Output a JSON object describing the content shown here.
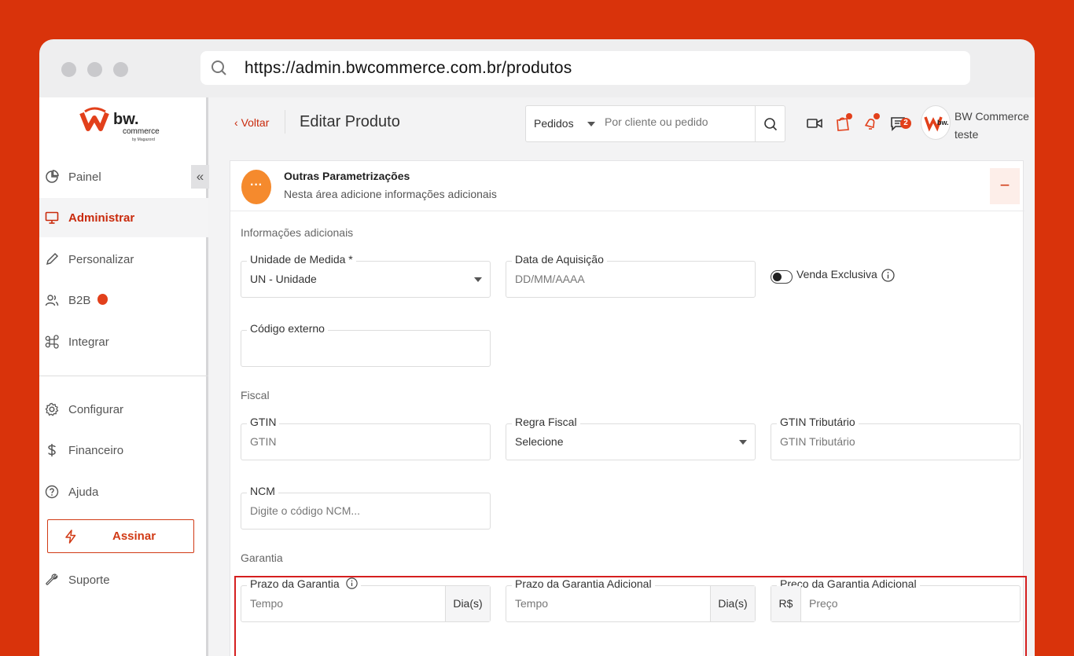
{
  "browser": {
    "url": "https://admin.bwcommerce.com.br/produtos"
  },
  "brand": {
    "logo_text": "bw.",
    "logo_sub": "commerce",
    "logo_by": "by Magazord",
    "accent": "#c92a0c"
  },
  "sidebar": {
    "items": [
      {
        "label": "Painel",
        "icon": "pie-chart-icon"
      },
      {
        "label": "Administrar",
        "icon": "monitor-icon",
        "active": true
      },
      {
        "label": "Personalizar",
        "icon": "pencil-icon"
      },
      {
        "label": "B2B",
        "icon": "users-icon"
      },
      {
        "label": "Integrar",
        "icon": "command-icon"
      },
      {
        "label": "Configurar",
        "icon": "gear-icon"
      },
      {
        "label": "Financeiro",
        "icon": "dollar-icon"
      },
      {
        "label": "Ajuda",
        "icon": "help-icon"
      }
    ],
    "assinar": "Assinar",
    "suporte": "Suporte",
    "collapse": "«"
  },
  "header": {
    "back": "Voltar",
    "title": "Editar Produto",
    "search_scope": "Pedidos",
    "search_placeholder": "Por cliente ou pedido",
    "chat_badge": "2",
    "user_name": "BW Commerce",
    "user_role": "teste"
  },
  "section": {
    "title": "Outras Parametrizações",
    "subtitle": "Nesta área adicione informações adicionais",
    "icon_text": "···",
    "collapse": "−"
  },
  "info": {
    "group": "Informações adicionais",
    "unidade_label": "Unidade de Medida *",
    "unidade_value": "UN - Unidade",
    "data_label": "Data de Aquisição",
    "data_placeholder": "DD/MM/AAAA",
    "venda_exclusiva": "Venda Exclusiva",
    "codigo_label": "Código externo"
  },
  "fiscal": {
    "group": "Fiscal",
    "gtin_label": "GTIN",
    "gtin_placeholder": "GTIN",
    "regra_label": "Regra Fiscal",
    "regra_value": "Selecione",
    "gtin_trib_label": "GTIN Tributário",
    "gtin_trib_placeholder": "GTIN Tributário",
    "ncm_label": "NCM",
    "ncm_placeholder": "Digite o código NCM..."
  },
  "garantia": {
    "group": "Garantia",
    "prazo_label": "Prazo da Garantia",
    "prazo_placeholder": "Tempo",
    "prazo_suffix": "Dia(s)",
    "prazo_adic_label": "Prazo da Garantia Adicional",
    "prazo_adic_placeholder": "Tempo",
    "prazo_adic_suffix": "Dia(s)",
    "preco_label": "Preço da Garantia Adicional",
    "preco_prefix": "R$",
    "preco_placeholder": "Preço"
  }
}
